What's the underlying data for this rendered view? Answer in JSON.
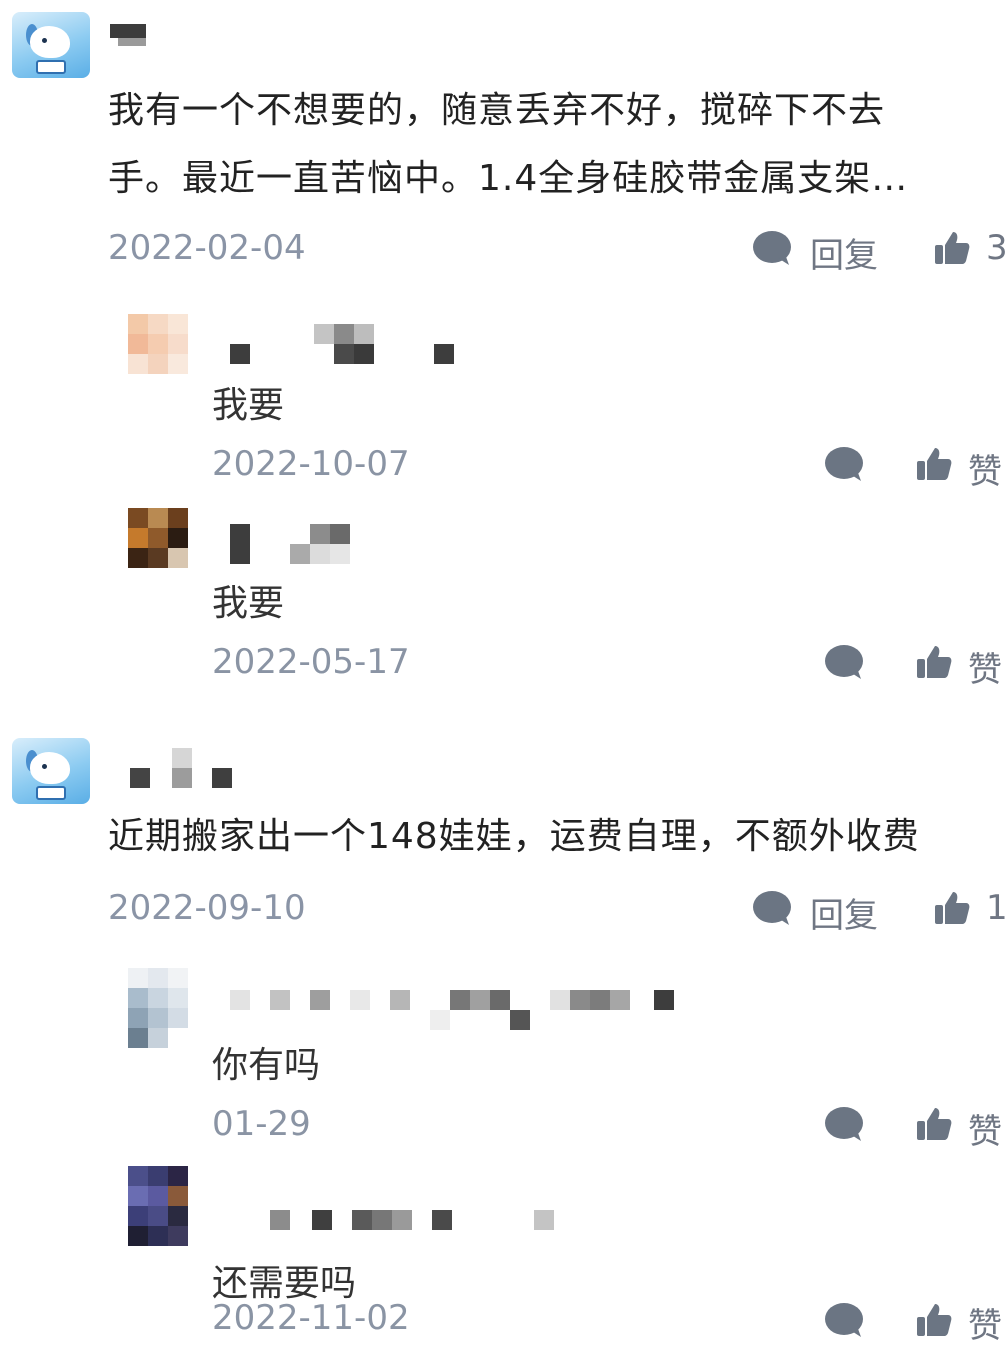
{
  "comments": [
    {
      "text_line1": "我有一个不想要的，随意丢弃不好，搅碎下不去",
      "text_line2": "手。最近一直苦恼中。1.4全身硅胶带金属支架…",
      "date": "2022-02-04",
      "reply_label": "回复",
      "like_count": "3",
      "replies": [
        {
          "text": "我要",
          "date": "2022-10-07",
          "like_label": "赞"
        },
        {
          "text": "我要",
          "date": "2022-05-17",
          "like_label": "赞"
        }
      ]
    },
    {
      "text_line1": "近期搬家出一个148娃娃，运费自理，不额外收费",
      "date": "2022-09-10",
      "reply_label": "回复",
      "like_count": "1",
      "replies": [
        {
          "text": "你有吗",
          "date": "01-29",
          "like_label": "赞"
        },
        {
          "text": "还需要吗",
          "date": "2022-11-02",
          "like_label": "赞"
        }
      ]
    }
  ],
  "icons": {
    "comment": "speech-bubble-icon",
    "like": "thumbs-up-icon",
    "avatar": "dog-avatar-icon"
  },
  "colors": {
    "meta_text": "#8a94a6",
    "icon_gray": "#6b7280"
  }
}
